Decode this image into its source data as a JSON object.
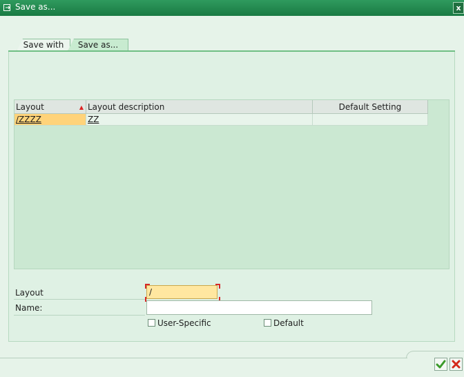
{
  "window": {
    "title": "Save as...",
    "title_icon": "save-as-icon",
    "close_icon": "close-icon",
    "close_glyph": "x"
  },
  "tabs": [
    {
      "label": "Save with",
      "active": false
    },
    {
      "label": "Save as...",
      "active": true
    }
  ],
  "grid": {
    "columns": [
      "Layout",
      "Layout description",
      "Default Setting"
    ],
    "sorted_column_marker": "sort-ascending-icon",
    "rows": [
      {
        "layout": "/ZZZZ",
        "description": "ZZ",
        "default_setting": ""
      }
    ]
  },
  "form": {
    "layout_label": "Layout",
    "layout_value": "/",
    "name_label": "Name:",
    "name_value": "",
    "user_specific_label": "User-Specific",
    "user_specific_checked": false,
    "default_label": "Default",
    "default_checked": false
  },
  "footer": {
    "confirm_icon": "checkmark-icon",
    "cancel_icon": "cancel-icon"
  },
  "colors": {
    "title_bar": "#197a43",
    "background": "#e6f3e9",
    "selected_cell": "#ffd37a",
    "confirm_green": "#3a9a2a",
    "cancel_red": "#d42a1a"
  }
}
